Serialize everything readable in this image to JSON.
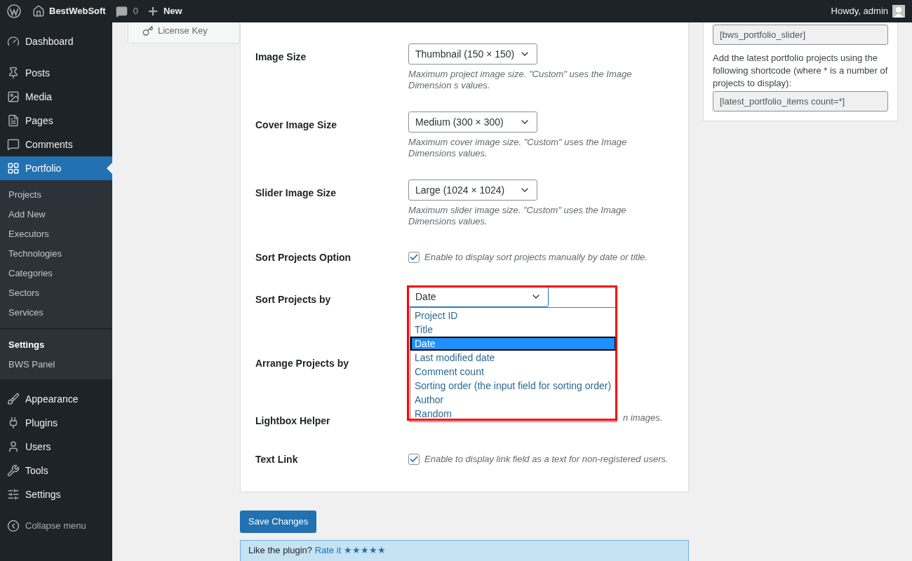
{
  "admin_bar": {
    "site_name": "BestWebSoft",
    "comments_count": "0",
    "new_label": "New",
    "greeting": "Howdy, admin"
  },
  "sidebar": {
    "groups": [
      [
        {
          "label": "Dashboard",
          "selected": false
        }
      ],
      [
        {
          "label": "Posts",
          "selected": false
        },
        {
          "label": "Media",
          "selected": false
        },
        {
          "label": "Pages",
          "selected": false
        },
        {
          "label": "Comments",
          "selected": false
        },
        {
          "label": "Portfolio",
          "selected": true,
          "children": [
            {
              "label": "Projects",
              "selected": false
            },
            {
              "label": "Add New",
              "selected": false
            },
            {
              "label": "Executors",
              "selected": false
            },
            {
              "label": "Technologies",
              "selected": false
            },
            {
              "label": "Categories",
              "selected": false
            },
            {
              "label": "Sectors",
              "selected": false
            },
            {
              "label": "Services",
              "selected": false
            },
            {
              "label": "Settings",
              "selected": true
            },
            {
              "label": "BWS Panel",
              "selected": false
            }
          ]
        }
      ],
      [
        {
          "label": "Appearance",
          "selected": false
        },
        {
          "label": "Plugins",
          "selected": false
        },
        {
          "label": "Users",
          "selected": false
        },
        {
          "label": "Tools",
          "selected": false
        },
        {
          "label": "Settings",
          "selected": false
        }
      ]
    ],
    "collapse_label": "Collapse menu"
  },
  "settings_tabs": [
    {
      "label": "License Key",
      "selected": false
    }
  ],
  "form": {
    "rows": [
      {
        "kind": "select",
        "label": "Image Size",
        "value": "Thumbnail (150 × 150)",
        "help": "Maximum project image size. \"Custom\" uses the Image Dimension s values."
      },
      {
        "kind": "select",
        "label": "Cover Image Size",
        "value": "Medium (300 × 300)",
        "help": "Maximum cover image size. \"Custom\" uses the Image Dimensions values."
      },
      {
        "kind": "select",
        "label": "Slider Image Size",
        "value": "Large (1024 × 1024)",
        "help": "Maximum slider image size. \"Custom\" uses the Image Dimensions values."
      },
      {
        "kind": "checkbox",
        "label": "Sort Projects Option",
        "checked": true,
        "help": "Enable to display sort projects manually by date or title."
      },
      {
        "kind": "open_select",
        "label": "Sort Projects by",
        "value": "Date",
        "options": [
          {
            "label": "Project ID",
            "selected": false
          },
          {
            "label": "Title",
            "selected": false
          },
          {
            "label": "Date",
            "selected": true
          },
          {
            "label": "Last modified date",
            "selected": false
          },
          {
            "label": "Comment count",
            "selected": false
          },
          {
            "label": "Sorting order (the input field for sorting order)",
            "selected": false
          },
          {
            "label": "Author",
            "selected": false
          },
          {
            "label": "Random",
            "selected": false
          }
        ]
      },
      {
        "kind": "covered",
        "label": "Arrange Projects by"
      },
      {
        "kind": "covered",
        "label": "Lightbox Helper",
        "help": "n images."
      },
      {
        "kind": "checkbox",
        "label": "Text Link",
        "checked": true,
        "help": "Enable to display link field as a text for non-registered users."
      }
    ]
  },
  "save_button": "Save Changes",
  "shortcodes": {
    "slider_code": "[bws_portfolio_slider]",
    "latest_text": "Add the latest portfolio projects using the following shortcode (where * is a number of projects to display):",
    "latest_code": "[latest_portfolio_items count=*]"
  },
  "notice": {
    "text": "Like the plugin?",
    "link": "Rate it ★★★★★"
  }
}
